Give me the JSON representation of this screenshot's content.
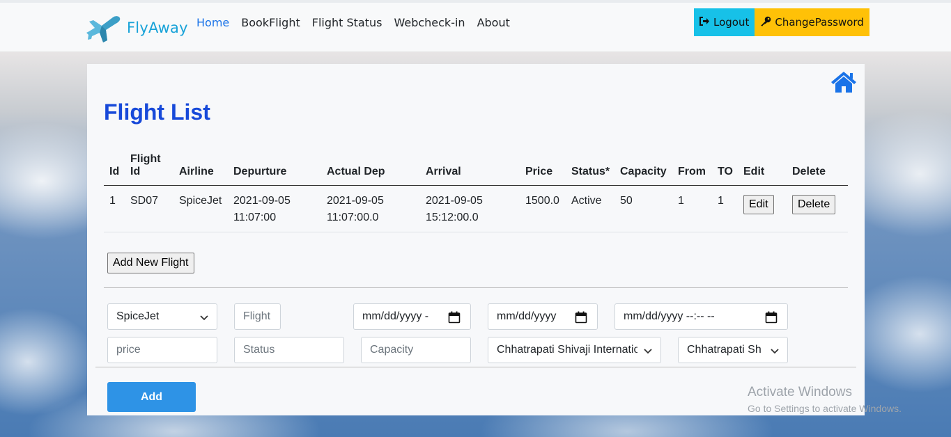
{
  "brand": {
    "name": "FlyAway",
    "icon": "airplane-icon"
  },
  "nav": {
    "links": [
      {
        "label": "Home",
        "active": true
      },
      {
        "label": "BookFlight",
        "active": false
      },
      {
        "label": "Flight Status",
        "active": false
      },
      {
        "label": "Webcheck-in",
        "active": false
      },
      {
        "label": "About",
        "active": false
      }
    ],
    "logout_label": "Logout",
    "change_password_label": "ChangePassword"
  },
  "page": {
    "title": "Flight List",
    "home_icon": "home-icon"
  },
  "table": {
    "headers": [
      "Id",
      "Flight Id",
      "Airline",
      "Depurture",
      "Actual Dep",
      "Arrival",
      "Price",
      "Status*",
      "Capacity",
      "From",
      "TO",
      "Edit",
      "Delete"
    ],
    "rows": [
      {
        "id": "1",
        "flight_id": "SD07",
        "airline": "SpiceJet",
        "departure": "2021-09-05 11:07:00",
        "actual_dep": "2021-09-05 11:07:00.0",
        "arrival": "2021-09-05 15:12:00.0",
        "price": "1500.0",
        "status": "Active",
        "capacity": "50",
        "from": "1",
        "to": "1",
        "edit_label": "Edit",
        "delete_label": "Delete"
      }
    ]
  },
  "add_new_flight_label": "Add New Flight",
  "form": {
    "airline_select": "SpiceJet",
    "flight_placeholder": "Flight",
    "date1_value": "mm/dd/yyyy -",
    "date2_value": "mm/dd/yyyy",
    "datetime_value": "mm/dd/yyyy --:-- --",
    "price_placeholder": "price",
    "status_placeholder": "Status",
    "capacity_placeholder": "Capacity",
    "from_select": "Chhatrapati Shivaji Internatio",
    "to_select": "Chhatrapati Sh",
    "add_label": "Add"
  },
  "watermark": {
    "title": "Activate Windows",
    "subtitle": "Go to Settings to activate Windows."
  },
  "colors": {
    "brand": "#17a2d8",
    "nav_active": "#1a73e8",
    "logout_bg": "#17c1e8",
    "change_bg": "#ffc107",
    "title": "#1749d9",
    "add_bg": "#2e93e6"
  }
}
